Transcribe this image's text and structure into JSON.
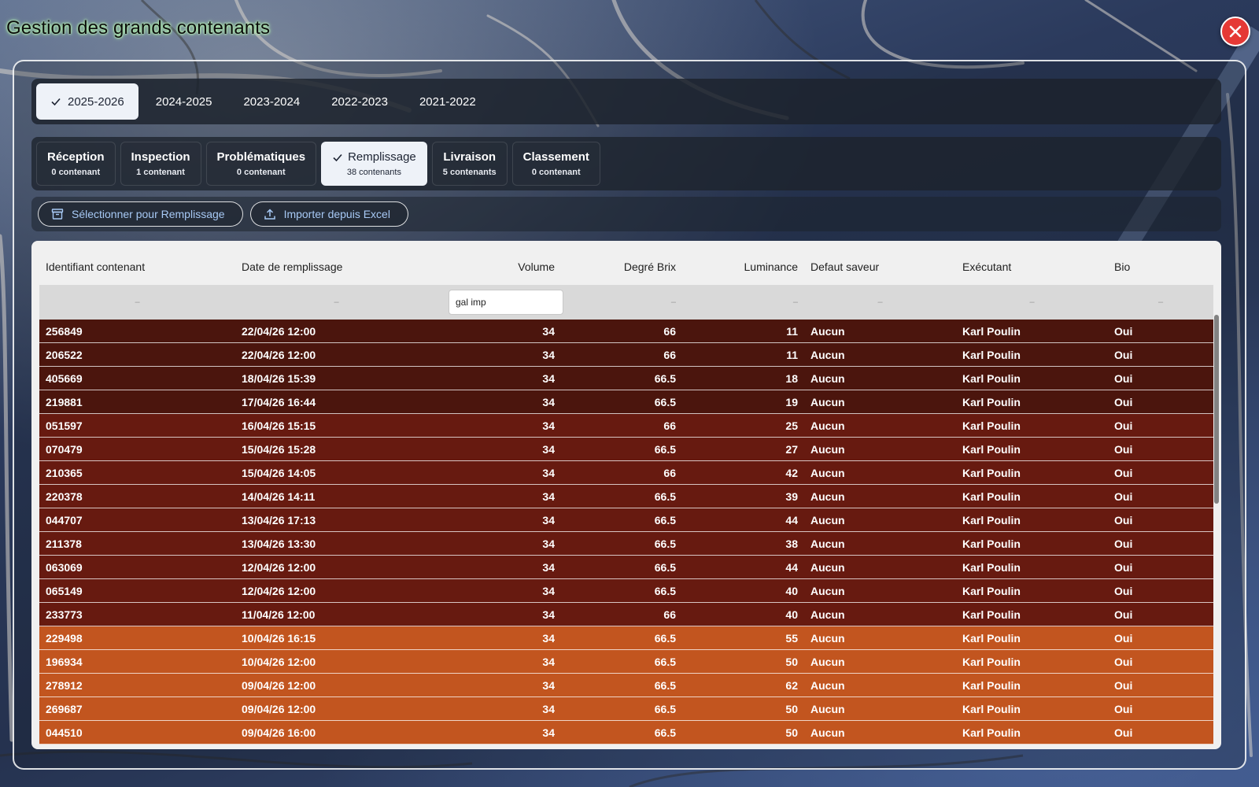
{
  "app": {
    "title": "Gestion des grands contenants"
  },
  "close_icon": "close-icon",
  "season_tabs": [
    {
      "label": "2025-2026",
      "active": true
    },
    {
      "label": "2024-2025",
      "active": false
    },
    {
      "label": "2023-2024",
      "active": false
    },
    {
      "label": "2022-2023",
      "active": false
    },
    {
      "label": "2021-2022",
      "active": false
    }
  ],
  "stage_tabs": [
    {
      "label": "Réception",
      "count": "0 contenant",
      "active": false
    },
    {
      "label": "Inspection",
      "count": "1 contenant",
      "active": false
    },
    {
      "label": "Problématiques",
      "count": "0 contenant",
      "active": false
    },
    {
      "label": "Remplissage",
      "count": "38 contenants",
      "active": true
    },
    {
      "label": "Livraison",
      "count": "5 contenants",
      "active": false
    },
    {
      "label": "Classement",
      "count": "0 contenant",
      "active": false
    }
  ],
  "actions": {
    "select_label": "Sélectionner pour Remplissage",
    "import_label": "Importer depuis Excel"
  },
  "table": {
    "headers": [
      "Identifiant contenant",
      "Date de remplissage",
      "Volume",
      "Degré Brix",
      "Luminance",
      "Defaut saveur",
      "Exécutant",
      "Bio"
    ],
    "filter_placeholder": "–",
    "volume_filter_value": "gal imp",
    "colors": {
      "dark_row": "#4b150d",
      "medium_row": "#671a10",
      "orange_row": "#c2551f"
    },
    "rows": [
      {
        "id": "256849",
        "date": "22/04/26 12:00",
        "volume": "34",
        "brix": "66",
        "luminance": "11",
        "defaut": "Aucun",
        "executant": "Karl Poulin",
        "bio": "Oui",
        "tone": "dark"
      },
      {
        "id": "206522",
        "date": "22/04/26 12:00",
        "volume": "34",
        "brix": "66",
        "luminance": "11",
        "defaut": "Aucun",
        "executant": "Karl Poulin",
        "bio": "Oui",
        "tone": "dark"
      },
      {
        "id": "405669",
        "date": "18/04/26 15:39",
        "volume": "34",
        "brix": "66.5",
        "luminance": "18",
        "defaut": "Aucun",
        "executant": "Karl Poulin",
        "bio": "Oui",
        "tone": "dark"
      },
      {
        "id": "219881",
        "date": "17/04/26 16:44",
        "volume": "34",
        "brix": "66.5",
        "luminance": "19",
        "defaut": "Aucun",
        "executant": "Karl Poulin",
        "bio": "Oui",
        "tone": "dark"
      },
      {
        "id": "051597",
        "date": "16/04/26 15:15",
        "volume": "34",
        "brix": "66",
        "luminance": "25",
        "defaut": "Aucun",
        "executant": "Karl Poulin",
        "bio": "Oui",
        "tone": "medium"
      },
      {
        "id": "070479",
        "date": "15/04/26 15:28",
        "volume": "34",
        "brix": "66.5",
        "luminance": "27",
        "defaut": "Aucun",
        "executant": "Karl Poulin",
        "bio": "Oui",
        "tone": "medium"
      },
      {
        "id": "210365",
        "date": "15/04/26 14:05",
        "volume": "34",
        "brix": "66",
        "luminance": "42",
        "defaut": "Aucun",
        "executant": "Karl Poulin",
        "bio": "Oui",
        "tone": "medium"
      },
      {
        "id": "220378",
        "date": "14/04/26 14:11",
        "volume": "34",
        "brix": "66.5",
        "luminance": "39",
        "defaut": "Aucun",
        "executant": "Karl Poulin",
        "bio": "Oui",
        "tone": "medium"
      },
      {
        "id": "044707",
        "date": "13/04/26 17:13",
        "volume": "34",
        "brix": "66.5",
        "luminance": "44",
        "defaut": "Aucun",
        "executant": "Karl Poulin",
        "bio": "Oui",
        "tone": "medium"
      },
      {
        "id": "211378",
        "date": "13/04/26 13:30",
        "volume": "34",
        "brix": "66.5",
        "luminance": "38",
        "defaut": "Aucun",
        "executant": "Karl Poulin",
        "bio": "Oui",
        "tone": "medium"
      },
      {
        "id": "063069",
        "date": "12/04/26 12:00",
        "volume": "34",
        "brix": "66.5",
        "luminance": "44",
        "defaut": "Aucun",
        "executant": "Karl Poulin",
        "bio": "Oui",
        "tone": "medium"
      },
      {
        "id": "065149",
        "date": "12/04/26 12:00",
        "volume": "34",
        "brix": "66.5",
        "luminance": "40",
        "defaut": "Aucun",
        "executant": "Karl Poulin",
        "bio": "Oui",
        "tone": "medium"
      },
      {
        "id": "233773",
        "date": "11/04/26 12:00",
        "volume": "34",
        "brix": "66",
        "luminance": "40",
        "defaut": "Aucun",
        "executant": "Karl Poulin",
        "bio": "Oui",
        "tone": "medium"
      },
      {
        "id": "229498",
        "date": "10/04/26 16:15",
        "volume": "34",
        "brix": "66.5",
        "luminance": "55",
        "defaut": "Aucun",
        "executant": "Karl Poulin",
        "bio": "Oui",
        "tone": "orange"
      },
      {
        "id": "196934",
        "date": "10/04/26 12:00",
        "volume": "34",
        "brix": "66.5",
        "luminance": "50",
        "defaut": "Aucun",
        "executant": "Karl Poulin",
        "bio": "Oui",
        "tone": "orange"
      },
      {
        "id": "278912",
        "date": "09/04/26 12:00",
        "volume": "34",
        "brix": "66.5",
        "luminance": "62",
        "defaut": "Aucun",
        "executant": "Karl Poulin",
        "bio": "Oui",
        "tone": "orange"
      },
      {
        "id": "269687",
        "date": "09/04/26 12:00",
        "volume": "34",
        "brix": "66.5",
        "luminance": "50",
        "defaut": "Aucun",
        "executant": "Karl Poulin",
        "bio": "Oui",
        "tone": "orange"
      },
      {
        "id": "044510",
        "date": "09/04/26 16:00",
        "volume": "34",
        "brix": "66.5",
        "luminance": "50",
        "defaut": "Aucun",
        "executant": "Karl Poulin",
        "bio": "Oui",
        "tone": "orange"
      }
    ]
  }
}
